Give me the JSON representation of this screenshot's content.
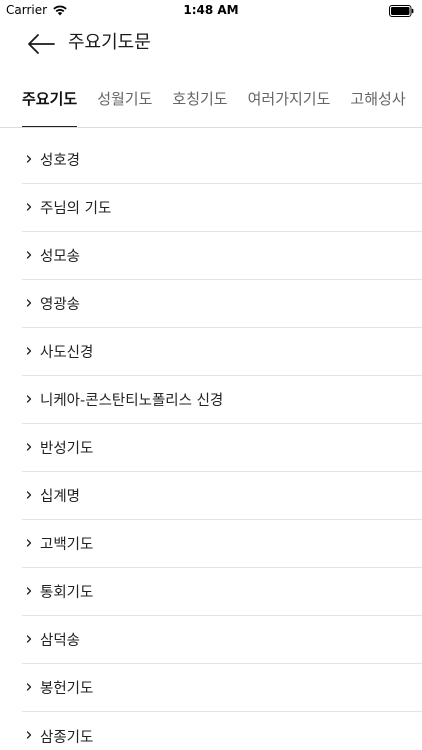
{
  "status_bar": {
    "carrier": "Carrier",
    "time": "1:48 AM",
    "wifi_icon": "wifi-icon",
    "battery_icon": "battery-icon"
  },
  "nav": {
    "back_icon": "arrow-left-icon",
    "title": "주요기도문"
  },
  "tabs": [
    {
      "label": "주요기도",
      "active": true
    },
    {
      "label": "성월기도",
      "active": false
    },
    {
      "label": "호칭기도",
      "active": false
    },
    {
      "label": "여러가지기도",
      "active": false
    },
    {
      "label": "고해성사",
      "active": false
    }
  ],
  "prayers": [
    {
      "label": "성호경"
    },
    {
      "label": "주님의 기도"
    },
    {
      "label": "성모송"
    },
    {
      "label": "영광송"
    },
    {
      "label": "사도신경"
    },
    {
      "label": "니케아-콘스탄티노폴리스 신경"
    },
    {
      "label": "반성기도"
    },
    {
      "label": "십계명"
    },
    {
      "label": "고백기도"
    },
    {
      "label": "통회기도"
    },
    {
      "label": "삼덕송"
    },
    {
      "label": "봉헌기도"
    },
    {
      "label": "삼종기도"
    }
  ],
  "colors": {
    "active_tab": "#111111",
    "inactive_tab": "#666666",
    "divider": "#e4e4e4"
  }
}
